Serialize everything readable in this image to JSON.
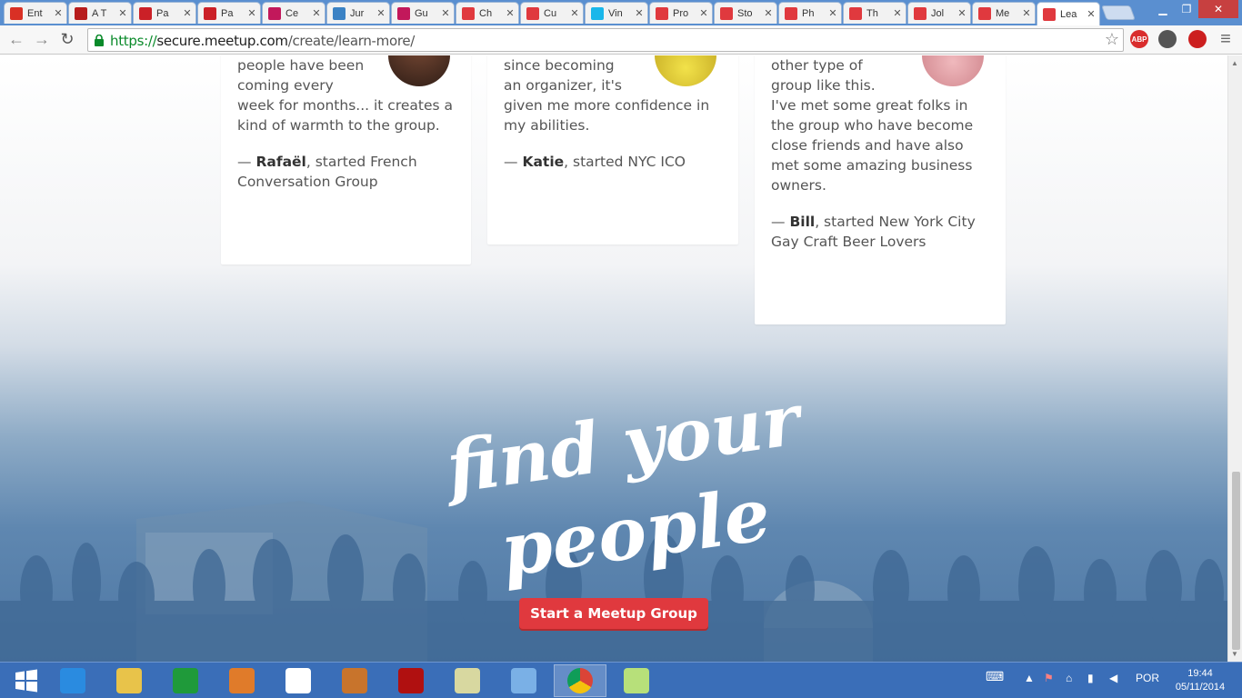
{
  "browser": {
    "tabs": [
      {
        "title": "Ent",
        "icon": "gmail-icon",
        "color": "#d93025"
      },
      {
        "title": "A T",
        "icon": "m-logo-icon",
        "color": "#b71c1c"
      },
      {
        "title": "Pa",
        "icon": "pinterest-icon",
        "color": "#cb2027"
      },
      {
        "title": "Pa",
        "icon": "pinterest-icon",
        "color": "#cb2027"
      },
      {
        "title": "Ce",
        "icon": "b-logo-icon",
        "color": "#c2185b"
      },
      {
        "title": "Jur",
        "icon": "globe-icon",
        "color": "#3b82c4"
      },
      {
        "title": "Gu",
        "icon": "b-logo-icon",
        "color": "#c2185b"
      },
      {
        "title": "Ch",
        "icon": "meetup-icon",
        "color": "#e0393e"
      },
      {
        "title": "Cu",
        "icon": "meetup-icon",
        "color": "#e0393e"
      },
      {
        "title": "Vin",
        "icon": "vimeo-icon",
        "color": "#1ab7ea"
      },
      {
        "title": "Pro",
        "icon": "meetup-icon",
        "color": "#e0393e"
      },
      {
        "title": "Sto",
        "icon": "meetup-icon",
        "color": "#e0393e"
      },
      {
        "title": "Ph",
        "icon": "meetup-icon",
        "color": "#e0393e"
      },
      {
        "title": "Th",
        "icon": "meetup-icon",
        "color": "#e0393e"
      },
      {
        "title": "Jol",
        "icon": "meetup-icon",
        "color": "#e0393e"
      },
      {
        "title": "Me",
        "icon": "meetup-icon",
        "color": "#e0393e"
      },
      {
        "title": "Lea",
        "icon": "meetup-icon",
        "color": "#e0393e",
        "active": true
      }
    ],
    "close_glyph": "✕",
    "address": {
      "scheme": "https://",
      "host": "secure.meetup.com",
      "path": "/create/learn-more/"
    },
    "extensions": [
      {
        "label": "ABP",
        "icon": "adblock-plus-icon",
        "color": "#d92d2d"
      },
      {
        "label": "",
        "icon": "puzzle-icon",
        "color": "#555555"
      },
      {
        "label": "",
        "icon": "power-icon",
        "color": "#cc1f1f"
      }
    ]
  },
  "testimonials": [
    {
      "quote": "people have been\ncoming every\nweek for months... it creates a\nkind of warmth to the group.",
      "name": "Rafaël",
      "detail": ", started French\nConversation Group"
    },
    {
      "quote": "since becoming\nan organizer, it's\ngiven me more confidence in\nmy abilities.",
      "name": "Katie",
      "detail": ", started NYC ICO"
    },
    {
      "quote": "other type of\ngroup like this.\nI've met some great folks in\nthe group who have become\nclose friends and have also\nmet some amazing business\nowners.",
      "name": "Bill",
      "detail": ", started New York City\nGay Craft Beer Lovers"
    }
  ],
  "dash": "— ",
  "slogan": {
    "line1": "find your",
    "line2": "people"
  },
  "cta_label": "Start a Meetup Group",
  "taskbar": {
    "apps": [
      {
        "icon": "internet-explorer-icon"
      },
      {
        "icon": "file-explorer-icon"
      },
      {
        "icon": "windows-store-icon"
      },
      {
        "icon": "paint-icon"
      },
      {
        "icon": "amazon-icon"
      },
      {
        "icon": "video-editor-icon"
      },
      {
        "icon": "filezilla-icon"
      },
      {
        "icon": "notepad-icon"
      },
      {
        "icon": "virtualbox-icon"
      },
      {
        "icon": "chrome-icon",
        "active": true
      },
      {
        "icon": "sticky-notes-icon"
      }
    ],
    "language": "POR",
    "time": "19:44",
    "date": "05/11/2014"
  }
}
